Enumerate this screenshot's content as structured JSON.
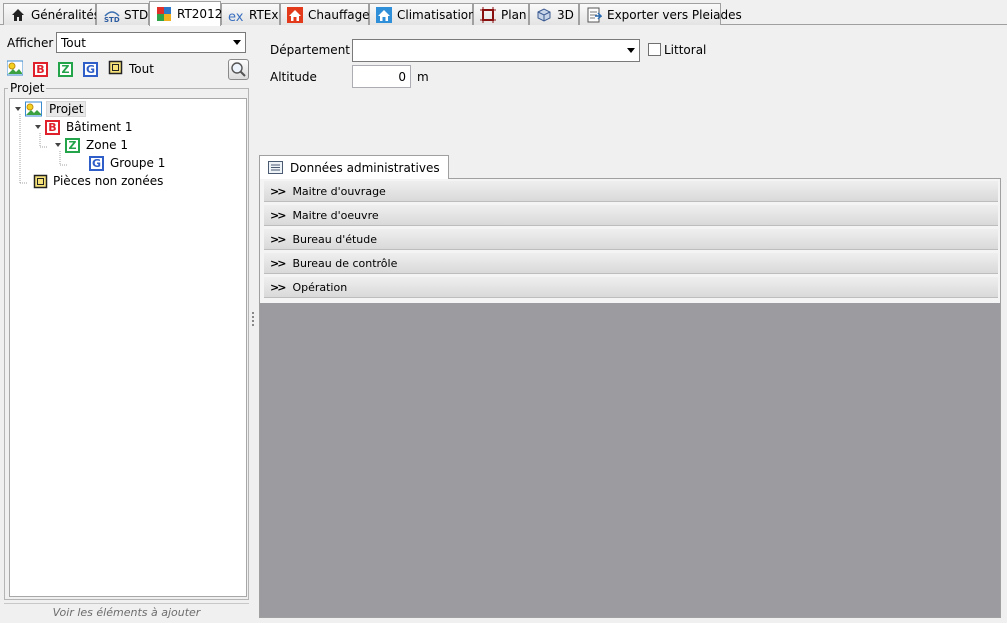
{
  "tabs": [
    {
      "label": "Généralités",
      "icon": "home-icon"
    },
    {
      "label": "STD",
      "icon": "std-icon"
    },
    {
      "label": "RT2012",
      "icon": "rt2012-icon",
      "active": true
    },
    {
      "label": "RTEx",
      "icon": "rtex-icon"
    },
    {
      "label": "Chauffage",
      "icon": "heating-house-icon"
    },
    {
      "label": "Climatisation",
      "icon": "cooling-house-icon"
    },
    {
      "label": "Plan",
      "icon": "plan-icon"
    },
    {
      "label": "3D",
      "icon": "3d-cube-icon"
    },
    {
      "label": "Exporter vers Pleiades",
      "icon": "export-icon"
    }
  ],
  "left": {
    "show_label": "Afficher",
    "show_value": "Tout",
    "filter": {
      "b": "B",
      "z": "Z",
      "g": "G",
      "all_label": "Tout"
    },
    "group_title": "Projet",
    "tree": {
      "projet": "Projet",
      "batiment": "Bâtiment 1",
      "zone": "Zone 1",
      "groupe": "Groupe 1",
      "pieces": "Pièces non zonées"
    },
    "bottom_hint": "Voir les éléments à ajouter"
  },
  "right": {
    "departement_label": "Département",
    "departement_value": "",
    "littoral_label": "Littoral",
    "littoral_checked": false,
    "altitude_label": "Altitude",
    "altitude_value": "0",
    "altitude_unit": "m",
    "admin_tab": "Données administratives",
    "sections": [
      "Maitre d'ouvrage",
      "Maitre d'oeuvre",
      "Bureau d'étude",
      "Bureau de contrôle",
      "Opération"
    ]
  },
  "colors": {
    "accent_b": "#e0202a",
    "accent_z": "#23a34a",
    "accent_g": "#2f5ec8",
    "panel_grey": "#9c9ca0"
  }
}
